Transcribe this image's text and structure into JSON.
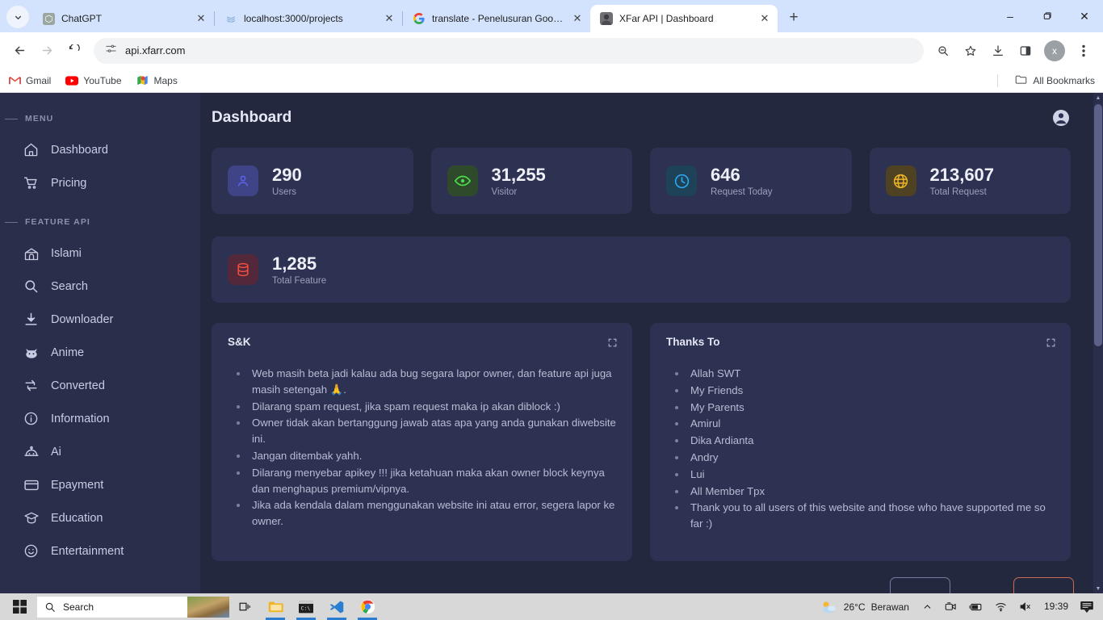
{
  "browser": {
    "tabs": [
      {
        "title": "ChatGPT",
        "icon": "chatgpt-icon",
        "active": false
      },
      {
        "title": "localhost:3000/projects",
        "icon": "vite-icon",
        "active": false
      },
      {
        "title": "translate - Penelusuran Google",
        "icon": "google-icon",
        "active": false
      },
      {
        "title": "XFar API | Dashboard",
        "icon": "xfar-icon",
        "active": true
      }
    ],
    "new_tab_label": "+",
    "window_controls": {
      "minimize": "–",
      "maximize": "❐",
      "close": "✕"
    },
    "nav": {
      "back": "←",
      "forward": "→",
      "reload": "↻"
    },
    "omnibox": {
      "url": "api.xfarr.com",
      "site_info_icon": "tune-icon"
    },
    "toolbar_icons": [
      "zoom-out-icon",
      "bookmark-star-icon",
      "downloads-icon",
      "side-panel-icon"
    ],
    "profile_initial": "x",
    "menu_icon": "kebab-menu-icon",
    "bookmarks": [
      {
        "label": "Gmail",
        "icon": "gmail-icon"
      },
      {
        "label": "YouTube",
        "icon": "youtube-icon"
      },
      {
        "label": "Maps",
        "icon": "maps-icon"
      }
    ],
    "all_bookmarks_label": "All Bookmarks"
  },
  "app": {
    "header": {
      "title": "Dashboard",
      "account_icon": "account-circle-icon"
    },
    "sidebar": {
      "sections": [
        {
          "label": "MENU",
          "items": [
            {
              "label": "Dashboard",
              "icon": "home-icon"
            },
            {
              "label": "Pricing",
              "icon": "shopping-cart-icon"
            }
          ]
        },
        {
          "label": "FEATURE API",
          "items": [
            {
              "label": "Islami",
              "icon": "mosque-icon"
            },
            {
              "label": "Search",
              "icon": "search-icon"
            },
            {
              "label": "Downloader",
              "icon": "download-icon"
            },
            {
              "label": "Anime",
              "icon": "cat-icon"
            },
            {
              "label": "Converted",
              "icon": "swap-icon"
            },
            {
              "label": "Information",
              "icon": "info-circle-icon"
            },
            {
              "label": "Ai",
              "icon": "robot-icon"
            },
            {
              "label": "Epayment",
              "icon": "credit-card-icon"
            },
            {
              "label": "Education",
              "icon": "graduation-cap-icon"
            },
            {
              "label": "Entertainment",
              "icon": "smiley-icon"
            }
          ]
        }
      ]
    },
    "stats": [
      {
        "value": "290",
        "label": "Users",
        "icon": "person-icon",
        "tile_bg": "#3f4486",
        "icon_color": "#5b63e8"
      },
      {
        "value": "31,255",
        "label": "Visitor",
        "icon": "eye-icon",
        "tile_bg": "#2f4a2b",
        "icon_color": "#4ade4a"
      },
      {
        "value": "646",
        "label": "Request Today",
        "icon": "clock-icon",
        "tile_bg": "#1e4258",
        "icon_color": "#2eaaf0"
      },
      {
        "value": "213,607",
        "label": "Total Request",
        "icon": "globe-icon",
        "tile_bg": "#4f4222",
        "icon_color": "#f0b429"
      }
    ],
    "stats_wide": [
      {
        "value": "1,285",
        "label": "Total Feature",
        "icon": "database-icon",
        "tile_bg": "#53283a",
        "icon_color": "#f0503c"
      }
    ],
    "panels": [
      {
        "title": "S&K",
        "expand_icon": "expand-icon",
        "items": [
          "Web masih beta jadi kalau ada bug segara lapor owner, dan feature api juga masih setengah 🙏.",
          "Dilarang spam request, jika spam request maka ip akan diblock :)",
          "Owner tidak akan bertanggung jawab atas apa yang anda gunakan diwebsite ini.",
          "Jangan ditembak yahh.",
          "Dilarang menyebar apikey !!! jika ketahuan maka akan owner block keynya dan menghapus premium/vipnya.",
          "Jika ada kendala dalam menggunakan website ini atau error, segera lapor ke owner."
        ]
      },
      {
        "title": "Thanks To",
        "expand_icon": "expand-icon",
        "items": [
          "Allah SWT",
          "My Friends",
          "My Parents",
          "Amirul",
          "Dika Ardianta",
          "Andry",
          "Lui",
          "All Member Tpx",
          "Thank you to all users of this website and those who have supported me so far :)"
        ]
      }
    ],
    "colors": {
      "page_bg": "#24283f",
      "sidebar_bg": "#2a2e4a",
      "card_bg": "#2e3252",
      "text_primary": "#e6e9f5",
      "text_muted": "#9ba0bb"
    }
  },
  "taskbar": {
    "start_label": "start-button",
    "search_placeholder": "Search",
    "apps": [
      {
        "name": "task-view-icon",
        "open": false
      },
      {
        "name": "file-explorer-icon",
        "open": true
      },
      {
        "name": "terminal-icon",
        "open": true
      },
      {
        "name": "vscode-icon",
        "open": true
      },
      {
        "name": "chrome-icon",
        "open": true
      }
    ],
    "weather": {
      "temp": "26°C",
      "condition": "Berawan"
    },
    "tray_icons": [
      "show-hidden-icon",
      "meet-camera-icon",
      "battery-icon",
      "wifi-icon",
      "volume-muted-icon"
    ],
    "clock": "19:39",
    "notification_icon": "notification-icon"
  }
}
